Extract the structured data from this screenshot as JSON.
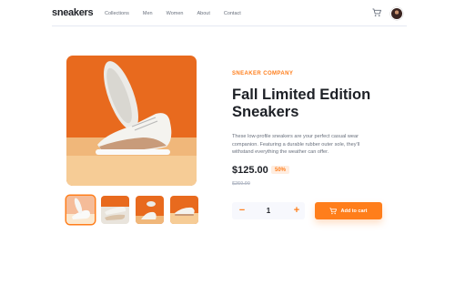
{
  "header": {
    "logo": "sneakers",
    "nav": [
      {
        "label": "Collections"
      },
      {
        "label": "Men"
      },
      {
        "label": "Women"
      },
      {
        "label": "About"
      },
      {
        "label": "Contact"
      }
    ],
    "cart_icon": "cart-icon",
    "avatar": "user-avatar"
  },
  "gallery": {
    "thumbnails": [
      {
        "name": "thumbnail-1",
        "selected": true
      },
      {
        "name": "thumbnail-2",
        "selected": false
      },
      {
        "name": "thumbnail-3",
        "selected": false
      },
      {
        "name": "thumbnail-4",
        "selected": false
      }
    ]
  },
  "product": {
    "company": "SNEAKER COMPANY",
    "title": "Fall Limited Edition Sneakers",
    "description": "These low-profile sneakers are your perfect casual wear companion. Featuring a durable rubber outer sole, they'll withstand everything the weather can offer.",
    "price": "$125.00",
    "discount": "50%",
    "old_price": "$250.00"
  },
  "cart_controls": {
    "minus": "−",
    "quantity": "1",
    "plus": "+",
    "add_label": "Add to cart"
  },
  "colors": {
    "accent": "#ff7e1b",
    "accent_pale": "#ffede0",
    "dark": "#1d2026",
    "gray": "#69707d"
  }
}
